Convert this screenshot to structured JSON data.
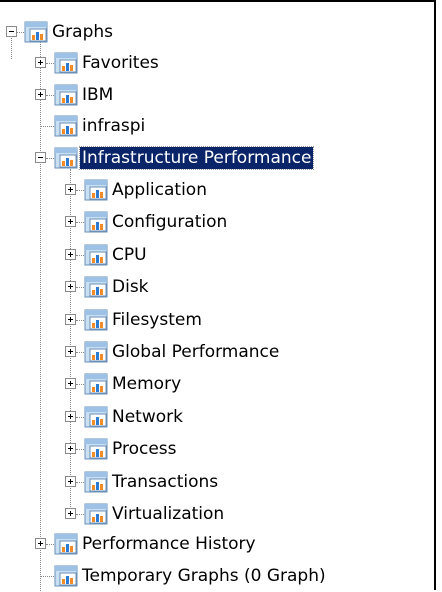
{
  "tree": {
    "root": {
      "label": "Graphs",
      "expanded": true
    },
    "level1": [
      {
        "label": "Favorites",
        "toggle": "plus"
      },
      {
        "label": "IBM",
        "toggle": "plus"
      },
      {
        "label": "infraspi",
        "toggle": "none"
      },
      {
        "label": "Infrastructure Performance",
        "toggle": "minus",
        "selected": true
      },
      {
        "label": "Performance History",
        "toggle": "plus"
      },
      {
        "label": "Temporary Graphs (0 Graph)",
        "toggle": "none"
      }
    ],
    "level2": [
      {
        "label": "Application"
      },
      {
        "label": "Configuration"
      },
      {
        "label": "CPU"
      },
      {
        "label": "Disk"
      },
      {
        "label": "Filesystem"
      },
      {
        "label": "Global Performance"
      },
      {
        "label": "Memory"
      },
      {
        "label": "Network"
      },
      {
        "label": "Process"
      },
      {
        "label": "Transactions"
      },
      {
        "label": "Virtualization"
      }
    ]
  },
  "colors": {
    "selection_bg": "#0a246a",
    "icon_folder_top": "#9ec2e6",
    "icon_chart_orange": "#f28c28"
  },
  "icons": {
    "graph_folder": "graph-folder-icon"
  }
}
